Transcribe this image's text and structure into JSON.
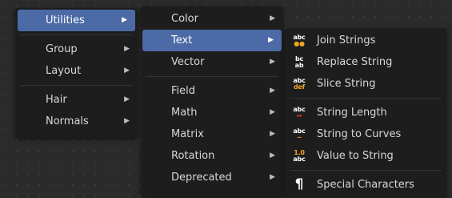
{
  "menu1": {
    "items": [
      {
        "label": "Utilities",
        "active": true
      },
      {
        "label": "Group"
      },
      {
        "label": "Layout"
      },
      {
        "label": "Hair"
      },
      {
        "label": "Normals"
      }
    ],
    "submenu_arrow": "▶"
  },
  "menu2": {
    "items": [
      {
        "label": "Color"
      },
      {
        "label": "Text",
        "active": true
      },
      {
        "label": "Vector"
      },
      {
        "label": "Field"
      },
      {
        "label": "Math"
      },
      {
        "label": "Matrix"
      },
      {
        "label": "Rotation"
      },
      {
        "label": "Deprecated"
      }
    ]
  },
  "menu3": {
    "items": [
      {
        "label": "Join Strings",
        "icon": "join-strings-icon",
        "icon_top": "abc",
        "icon_bottom": "●●"
      },
      {
        "label": "Replace String",
        "icon": "replace-string-icon",
        "icon_top": "bc",
        "icon_bottom": "ab"
      },
      {
        "label": "Slice String",
        "icon": "slice-string-icon",
        "icon_top": "abc",
        "icon_bottom": "def"
      },
      {
        "label": "String Length",
        "icon": "string-length-icon",
        "icon_top": "abc",
        "icon_bottom": "↔"
      },
      {
        "label": "String to Curves",
        "icon": "string-to-curves-icon",
        "icon_top": "abc",
        "icon_bottom": "~"
      },
      {
        "label": "Value to String",
        "icon": "value-to-string-icon",
        "icon_top": "1.0",
        "icon_bottom": "abc"
      },
      {
        "label": "Special Characters",
        "icon": "pilcrow-icon",
        "icon_glyph": "¶"
      }
    ]
  },
  "colors": {
    "highlight": "#4b6aa6",
    "menu_bg": "#1d1d1d",
    "icon_accent": "#f0a623"
  }
}
